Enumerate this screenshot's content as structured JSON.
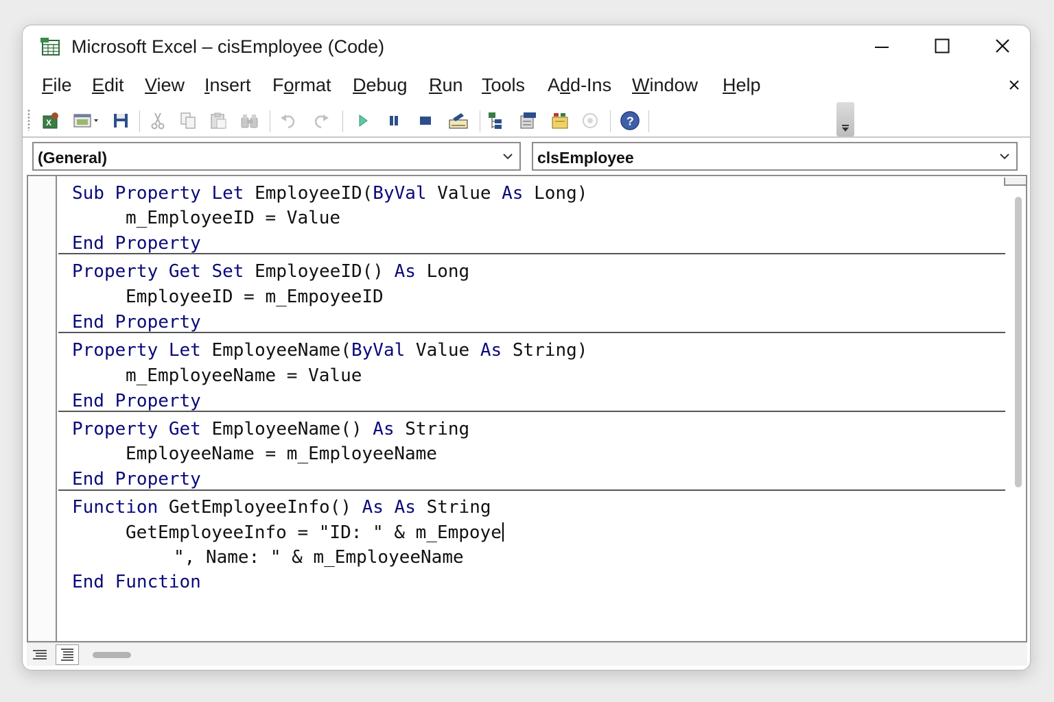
{
  "window": {
    "title": "Microsoft Excel – cisEmployee (Code)"
  },
  "menu": {
    "items": [
      "File",
      "Edit",
      "View",
      "Insert",
      "Format",
      "Debug",
      "Run",
      "Tools",
      "Add-Ins",
      "Window",
      "Help"
    ],
    "accelerators": [
      "F",
      "E",
      "V",
      "I",
      "o",
      "D",
      "R",
      "T",
      "d",
      "W",
      "H"
    ]
  },
  "toolbar": {
    "icons": [
      "view-excel-icon",
      "insert-userform-icon",
      "save-icon",
      "cut-icon",
      "copy-icon",
      "paste-icon",
      "find-icon",
      "undo-icon",
      "redo-icon",
      "run-icon",
      "break-icon",
      "reset-icon",
      "design-mode-icon",
      "project-explorer-icon",
      "properties-window-icon",
      "object-browser-icon",
      "toolbox-icon",
      "help-icon"
    ]
  },
  "combos": {
    "object": "(General)",
    "procedure": "clsEmployee"
  },
  "code": {
    "lines": [
      {
        "indent": 0,
        "tokens": [
          {
            "t": "Sub Property Let",
            "kw": true
          },
          {
            "t": " EmployeeID(",
            "kw": false
          },
          {
            "t": "ByVal",
            "kw": true
          },
          {
            "t": " Value ",
            "kw": false
          },
          {
            "t": "As",
            "kw": true
          },
          {
            "t": " Long)",
            "kw": false
          }
        ]
      },
      {
        "indent": 1,
        "tokens": [
          {
            "t": "m_EmployeeID = Value",
            "kw": false
          }
        ]
      },
      {
        "indent": 0,
        "tokens": [
          {
            "t": "End Property",
            "kw": true
          }
        ]
      },
      {
        "indent": 0,
        "tokens": [
          {
            "t": "Property Get Set",
            "kw": true
          },
          {
            "t": " EmployeeID() ",
            "kw": false
          },
          {
            "t": "As",
            "kw": true
          },
          {
            "t": " Long",
            "kw": false
          }
        ]
      },
      {
        "indent": 1,
        "tokens": [
          {
            "t": "EmployeeID = m_EmpoyeeID",
            "kw": false
          }
        ]
      },
      {
        "indent": 0,
        "tokens": [
          {
            "t": "End Property",
            "kw": true
          }
        ]
      },
      {
        "indent": 0,
        "tokens": [
          {
            "t": "Property Let",
            "kw": true
          },
          {
            "t": " EmployeeName(",
            "kw": false
          },
          {
            "t": "ByVal",
            "kw": true
          },
          {
            "t": " Value ",
            "kw": false
          },
          {
            "t": "As",
            "kw": true
          },
          {
            "t": " String)",
            "kw": false
          }
        ]
      },
      {
        "indent": 1,
        "tokens": [
          {
            "t": "m_EmployeeName = Value",
            "kw": false
          }
        ]
      },
      {
        "indent": 0,
        "tokens": [
          {
            "t": "End Property",
            "kw": true
          }
        ]
      },
      {
        "indent": 0,
        "tokens": [
          {
            "t": "Property Get",
            "kw": true
          },
          {
            "t": " EmployeeName() ",
            "kw": false
          },
          {
            "t": "As",
            "kw": true
          },
          {
            "t": " String",
            "kw": false
          }
        ]
      },
      {
        "indent": 1,
        "tokens": [
          {
            "t": "EmployeeName = m_EmployeeName",
            "kw": false
          }
        ]
      },
      {
        "indent": 0,
        "tokens": [
          {
            "t": "End Property",
            "kw": true
          }
        ]
      },
      {
        "indent": 0,
        "tokens": [
          {
            "t": "Function",
            "kw": true
          },
          {
            "t": " GetEmployeeInfo() ",
            "kw": false
          },
          {
            "t": "As As",
            "kw": true
          },
          {
            "t": " String",
            "kw": false
          }
        ]
      },
      {
        "indent": 1,
        "tokens": [
          {
            "t": "GetEmployeeInfo = \"ID: \" & m_Empoye",
            "kw": false
          }
        ],
        "caret": true
      },
      {
        "indent": 2,
        "tokens": [
          {
            "t": "\", Name: \" & m_EmployeeName",
            "kw": false
          }
        ]
      },
      {
        "indent": 0,
        "tokens": [
          {
            "t": "End Function",
            "kw": true
          }
        ]
      }
    ]
  },
  "colors": {
    "keyword": "#0a0a7a",
    "identifier": "#111111"
  }
}
